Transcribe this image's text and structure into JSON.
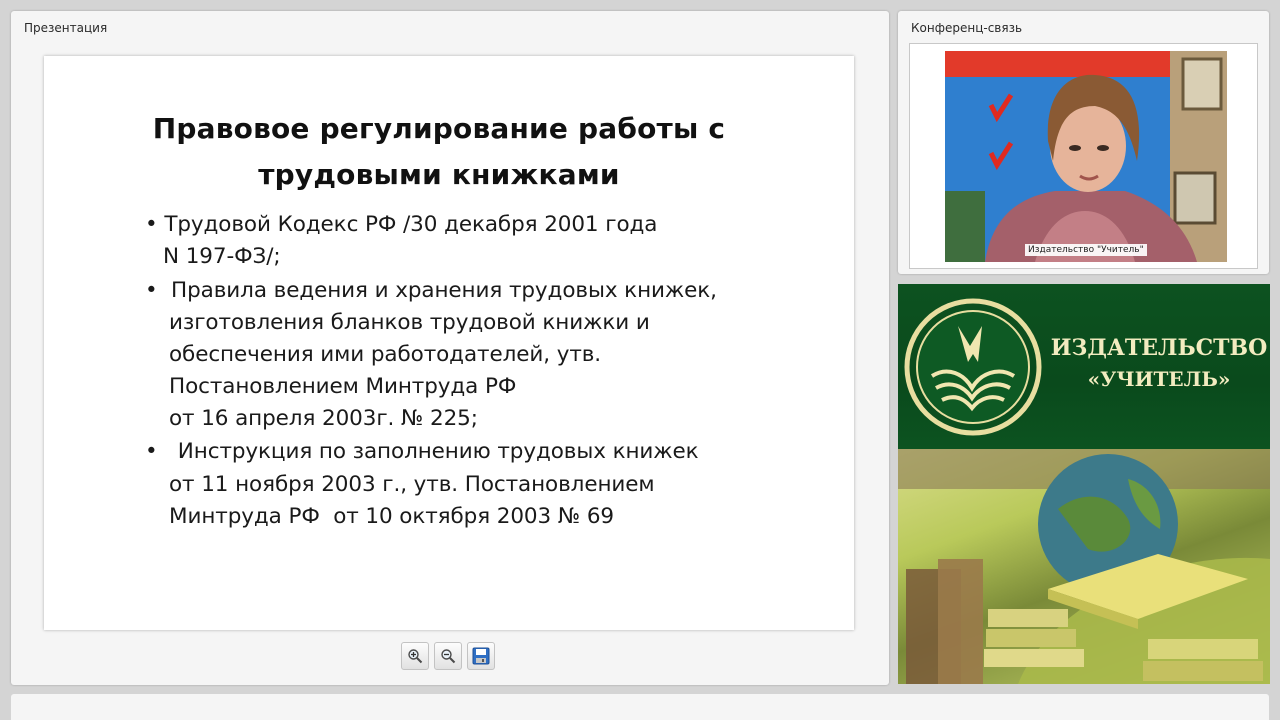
{
  "presentation": {
    "panel_title": "Презентация",
    "slide": {
      "title_line1": "Правовое регулирование работы с",
      "title_line2": "трудовыми книжками",
      "lines": [
        "• Трудовой Кодекс РФ /30 декабря 2001 года",
        "N 197-ФЗ/;",
        "•  Правила ведения и хранения трудовых книжек,",
        "изготовления бланков трудовой книжки и",
        "обеспечения ими работодателей, утв.",
        "Постановлением Минтруда РФ",
        "от 16 апреля 2003г. № 225;",
        "•   Инструкция по заполнению трудовых книжек",
        "от 11 ноября 2003 г., утв. Постановлением",
        "Минтруда РФ  от 10 октября 2003 № 69"
      ]
    },
    "toolbar": {
      "zoom_in_icon": "zoom-in-icon",
      "zoom_out_icon": "zoom-out-icon",
      "save_icon": "save-icon"
    }
  },
  "conference": {
    "panel_title": "Конференц-связь",
    "video_caption": "Издательство \"Учитель\""
  },
  "banner": {
    "publisher_line1": "ИЗДАТЕЛЬСТВО",
    "publisher_line2": "«УЧИТЕЛЬ»"
  },
  "colors": {
    "banner_green": "#0b4d1e",
    "banner_text": "#f3ecc0"
  }
}
